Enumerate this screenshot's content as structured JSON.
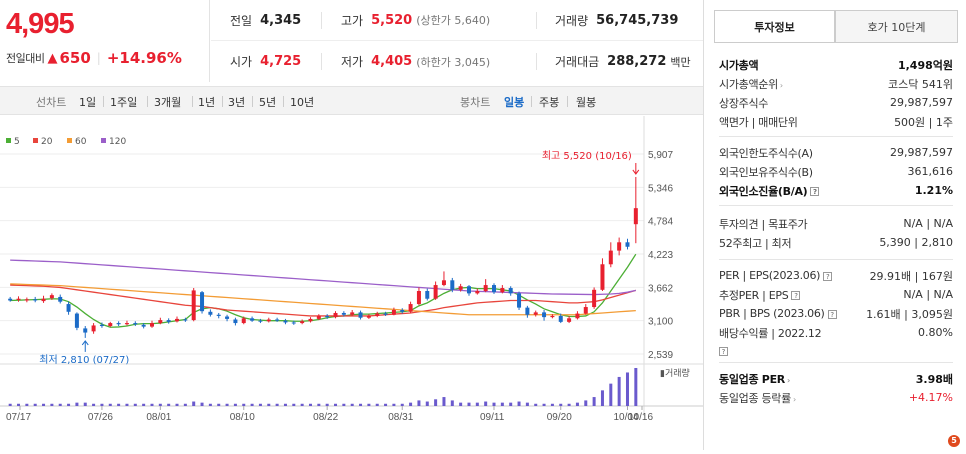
{
  "price": {
    "current": "4,995",
    "diff_label": "전일대비",
    "diff_arrow": "▲",
    "diff_value": "650",
    "diff_rate": "+14.96%"
  },
  "stats": {
    "prev_label": "전일",
    "prev_value": "4,345",
    "high_label": "고가",
    "high_value": "5,520",
    "high_sub": "(상한가 5,640)",
    "volume_label": "거래량",
    "volume_value": "56,745,739",
    "open_label": "시가",
    "open_value": "4,725",
    "low_label": "저가",
    "low_value": "4,405",
    "low_sub": "(하한가 3,045)",
    "amount_label": "거래대금",
    "amount_value": "288,272",
    "amount_unit": "백만"
  },
  "period_tabs": {
    "label": "선차트",
    "items": [
      "1일",
      "1주일",
      "3개월",
      "1년",
      "3년",
      "5년",
      "10년"
    ]
  },
  "candle_tabs": {
    "label": "봉차트",
    "items": [
      "일봉",
      "주봉",
      "월봉"
    ],
    "active": "일봉"
  },
  "legend": [
    {
      "label": "5",
      "color": "#4caf35"
    },
    {
      "label": "20",
      "color": "#e8453c"
    },
    {
      "label": "60",
      "color": "#f39c35"
    },
    {
      "label": "120",
      "color": "#9b5fc9"
    }
  ],
  "chart_data": {
    "type": "candlestick",
    "y_ticks": [
      "5,907",
      "5,346",
      "4,784",
      "4,223",
      "3,662",
      "3,100",
      "2,539"
    ],
    "x_ticks": [
      "07/17",
      "07/26",
      "08/01",
      "08/10",
      "08/22",
      "08/31",
      "09/11",
      "09/20",
      "10/04",
      "10/16"
    ],
    "high_annotation": "최고 5,520 (10/16)",
    "low_annotation": "최저 2,810 (07/27)",
    "volume_label": "거래량",
    "up_color": "#e8202f",
    "down_color": "#1b6bc7",
    "candles": [
      [
        3470,
        3440,
        3500,
        3420
      ],
      [
        3450,
        3470,
        3510,
        3420
      ],
      [
        3440,
        3460,
        3490,
        3410
      ],
      [
        3460,
        3440,
        3500,
        3410
      ],
      [
        3430,
        3470,
        3520,
        3400
      ],
      [
        3480,
        3530,
        3560,
        3450
      ],
      [
        3500,
        3420,
        3540,
        3390
      ],
      [
        3380,
        3250,
        3420,
        3200
      ],
      [
        3220,
        2980,
        3240,
        2940
      ],
      [
        2970,
        2900,
        3010,
        2810
      ],
      [
        2920,
        3020,
        3060,
        2880
      ],
      [
        3030,
        3010,
        3070,
        2980
      ],
      [
        3010,
        3060,
        3080,
        2990
      ],
      [
        3060,
        3040,
        3090,
        3010
      ],
      [
        3040,
        3060,
        3100,
        3020
      ],
      [
        3060,
        3040,
        3090,
        3010
      ],
      [
        3030,
        3000,
        3060,
        2970
      ],
      [
        3000,
        3060,
        3100,
        2980
      ],
      [
        3060,
        3110,
        3150,
        3040
      ],
      [
        3110,
        3080,
        3140,
        3050
      ],
      [
        3090,
        3130,
        3170,
        3070
      ],
      [
        3120,
        3110,
        3150,
        3080
      ],
      [
        3110,
        3610,
        3650,
        3090
      ],
      [
        3580,
        3260,
        3600,
        3220
      ],
      [
        3250,
        3200,
        3290,
        3170
      ],
      [
        3200,
        3180,
        3230,
        3140
      ],
      [
        3170,
        3130,
        3200,
        3090
      ],
      [
        3120,
        3060,
        3150,
        3020
      ],
      [
        3060,
        3140,
        3170,
        3040
      ],
      [
        3140,
        3100,
        3170,
        3080
      ],
      [
        3100,
        3090,
        3130,
        3060
      ],
      [
        3090,
        3120,
        3150,
        3070
      ],
      [
        3120,
        3100,
        3150,
        3080
      ],
      [
        3100,
        3070,
        3130,
        3040
      ],
      [
        3070,
        3060,
        3100,
        3030
      ],
      [
        3060,
        3090,
        3120,
        3040
      ],
      [
        3090,
        3130,
        3160,
        3070
      ],
      [
        3130,
        3180,
        3210,
        3110
      ],
      [
        3180,
        3160,
        3210,
        3130
      ],
      [
        3160,
        3230,
        3260,
        3140
      ],
      [
        3230,
        3200,
        3260,
        3170
      ],
      [
        3200,
        3240,
        3280,
        3180
      ],
      [
        3240,
        3150,
        3270,
        3120
      ],
      [
        3150,
        3180,
        3210,
        3130
      ],
      [
        3180,
        3220,
        3250,
        3160
      ],
      [
        3220,
        3200,
        3250,
        3180
      ],
      [
        3200,
        3280,
        3320,
        3190
      ],
      [
        3280,
        3250,
        3310,
        3220
      ],
      [
        3250,
        3380,
        3420,
        3230
      ],
      [
        3380,
        3600,
        3660,
        3360
      ],
      [
        3600,
        3470,
        3640,
        3440
      ],
      [
        3470,
        3700,
        3760,
        3450
      ],
      [
        3700,
        3780,
        3930,
        3680
      ],
      [
        3780,
        3620,
        3820,
        3580
      ],
      [
        3620,
        3680,
        3720,
        3590
      ],
      [
        3680,
        3560,
        3700,
        3520
      ],
      [
        3560,
        3600,
        3640,
        3540
      ],
      [
        3600,
        3700,
        3800,
        3580
      ],
      [
        3700,
        3580,
        3730,
        3550
      ],
      [
        3580,
        3650,
        3700,
        3560
      ],
      [
        3650,
        3560,
        3680,
        3520
      ],
      [
        3560,
        3320,
        3590,
        3280
      ],
      [
        3320,
        3200,
        3350,
        3150
      ],
      [
        3200,
        3240,
        3270,
        3170
      ],
      [
        3240,
        3160,
        3280,
        3100
      ],
      [
        3160,
        3180,
        3210,
        3140
      ],
      [
        3180,
        3080,
        3220,
        3060
      ],
      [
        3080,
        3140,
        3180,
        3060
      ],
      [
        3140,
        3220,
        3260,
        3120
      ],
      [
        3220,
        3330,
        3380,
        3200
      ],
      [
        3330,
        3620,
        3660,
        3300
      ],
      [
        3620,
        4050,
        4150,
        3600
      ],
      [
        4050,
        4280,
        4420,
        4000
      ],
      [
        4280,
        4420,
        4500,
        4200
      ],
      [
        4420,
        4345,
        4480,
        4300
      ],
      [
        4725,
        4995,
        5520,
        4405
      ]
    ],
    "ma_series": [
      {
        "name": "5",
        "color": "#4caf35",
        "values": [
          3440,
          3445,
          3450,
          3455,
          3460,
          3470,
          3465,
          3420,
          3330,
          3220,
          3120,
          3040,
          2990,
          2995,
          3010,
          3040,
          3050,
          3050,
          3060,
          3080,
          3100,
          3120,
          3240,
          3300,
          3320,
          3300,
          3260,
          3200,
          3150,
          3120,
          3110,
          3100,
          3100,
          3100,
          3090,
          3090,
          3100,
          3120,
          3150,
          3170,
          3180,
          3200,
          3210,
          3210,
          3220,
          3230,
          3240,
          3250,
          3270,
          3350,
          3400,
          3480,
          3560,
          3620,
          3650,
          3660,
          3640,
          3640,
          3640,
          3620,
          3600,
          3530,
          3450,
          3380,
          3300,
          3250,
          3200,
          3170,
          3170,
          3180,
          3250,
          3400,
          3600,
          3800,
          4000,
          4220
        ]
      },
      {
        "name": "20",
        "color": "#e8453c",
        "values": [
          3700,
          3695,
          3690,
          3685,
          3680,
          3670,
          3660,
          3640,
          3620,
          3600,
          3580,
          3560,
          3540,
          3520,
          3500,
          3480,
          3460,
          3440,
          3420,
          3400,
          3380,
          3360,
          3350,
          3340,
          3320,
          3300,
          3280,
          3270,
          3260,
          3250,
          3240,
          3230,
          3220,
          3210,
          3200,
          3190,
          3180,
          3180,
          3180,
          3180,
          3180,
          3180,
          3180,
          3180,
          3190,
          3200,
          3210,
          3220,
          3230,
          3250,
          3270,
          3290,
          3320,
          3340,
          3360,
          3380,
          3400,
          3410,
          3420,
          3430,
          3440,
          3440,
          3440,
          3440,
          3430,
          3420,
          3410,
          3400,
          3400,
          3410,
          3420,
          3450,
          3490,
          3530,
          3570,
          3610
        ]
      },
      {
        "name": "60",
        "color": "#f39c35",
        "values": [
          3720,
          3715,
          3710,
          3705,
          3700,
          3695,
          3690,
          3680,
          3670,
          3660,
          3650,
          3640,
          3630,
          3620,
          3610,
          3600,
          3590,
          3580,
          3570,
          3560,
          3550,
          3540,
          3530,
          3520,
          3510,
          3500,
          3490,
          3480,
          3470,
          3460,
          3450,
          3440,
          3430,
          3420,
          3410,
          3400,
          3390,
          3380,
          3370,
          3360,
          3350,
          3340,
          3330,
          3320,
          3310,
          3300,
          3290,
          3280,
          3270,
          3260,
          3250,
          3240,
          3230,
          3220,
          3210,
          3200,
          3200,
          3200,
          3200,
          3200,
          3200,
          3200,
          3200,
          3200,
          3200,
          3200,
          3200,
          3200,
          3200,
          3210,
          3220,
          3230,
          3240,
          3250,
          3260,
          3270
        ]
      },
      {
        "name": "120",
        "color": "#9b5fc9",
        "values": [
          4120,
          4115,
          4110,
          4105,
          4100,
          4095,
          4090,
          4080,
          4070,
          4060,
          4050,
          4040,
          4030,
          4020,
          4010,
          4000,
          3990,
          3980,
          3970,
          3960,
          3950,
          3940,
          3930,
          3920,
          3910,
          3900,
          3890,
          3880,
          3870,
          3860,
          3850,
          3840,
          3830,
          3820,
          3810,
          3800,
          3790,
          3780,
          3770,
          3760,
          3750,
          3740,
          3730,
          3720,
          3710,
          3700,
          3690,
          3680,
          3670,
          3660,
          3650,
          3640,
          3630,
          3620,
          3610,
          3600,
          3595,
          3590,
          3585,
          3580,
          3575,
          3570,
          3565,
          3560,
          3555,
          3550,
          3548,
          3546,
          3544,
          3542,
          3540,
          3545,
          3550,
          3560,
          3580,
          3610
        ]
      }
    ],
    "volumes": [
      2,
      2,
      2,
      2,
      2,
      2,
      2,
      2,
      3,
      3,
      2,
      2,
      2,
      2,
      2,
      2,
      2,
      2,
      2,
      2,
      2,
      2,
      4,
      3,
      2,
      2,
      2,
      2,
      2,
      2,
      2,
      2,
      2,
      2,
      2,
      2,
      2,
      2,
      2,
      2,
      2,
      2,
      2,
      2,
      2,
      2,
      2,
      2,
      3,
      5,
      4,
      6,
      8,
      5,
      3,
      3,
      3,
      4,
      3,
      3,
      3,
      4,
      3,
      2,
      2,
      2,
      2,
      2,
      3,
      5,
      8,
      14,
      20,
      26,
      30,
      34
    ]
  },
  "invest_tabs": {
    "active": "투자정보",
    "other": "호가 10단계"
  },
  "info": {
    "g1": [
      {
        "k": "시가총액",
        "v": "1,498억원",
        "bold": true
      },
      {
        "k": "시가총액순위",
        "v": "코스닥 541위",
        "arrow": true
      },
      {
        "k": "상장주식수",
        "v": "29,987,597"
      },
      {
        "k": "액면가 | 매매단위",
        "v": "500원 | 1주"
      }
    ],
    "g2": [
      {
        "k": "외국인한도주식수(A)",
        "v": "29,987,597"
      },
      {
        "k": "외국인보유주식수(B)",
        "v": "361,616"
      },
      {
        "k": "외국인소진율(B/A)",
        "v": "1.21%",
        "bold": true,
        "q": true
      }
    ],
    "g3": [
      {
        "k": "투자의견 | 목표주가",
        "v": "N/A | N/A"
      },
      {
        "k": "52주최고 | 최저",
        "v": "5,390 | 2,810"
      }
    ],
    "g4": [
      {
        "k": "PER | EPS(2023.06)",
        "v": "29.91배 | 167원",
        "q": true
      },
      {
        "k": "추정PER | EPS",
        "v": "N/A | N/A",
        "q": true
      },
      {
        "k": "PBR | BPS (2023.06)",
        "v": "1.61배 | 3,095원",
        "q": true
      },
      {
        "k": "배당수익률 | 2022.12",
        "v": "0.80%",
        "q2": true
      }
    ],
    "g5": [
      {
        "k": "동일업종 PER",
        "v": "3.98배",
        "bold": true,
        "arrow": true
      },
      {
        "k": "동일업종 등락률",
        "v": "+4.17%",
        "arrow": true,
        "red": true
      }
    ]
  },
  "badge": "5"
}
